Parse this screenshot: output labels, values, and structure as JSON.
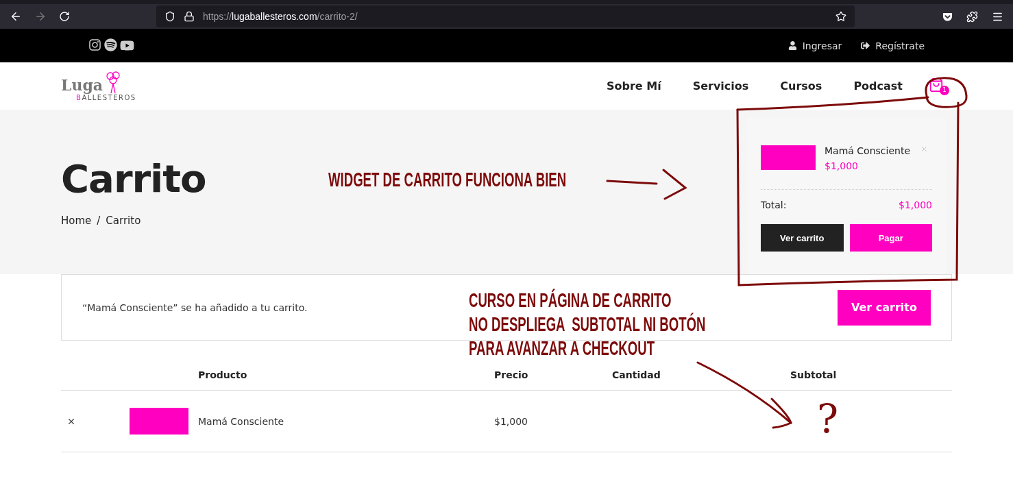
{
  "browser": {
    "url_scheme": "https://",
    "url_domain": "lugaballesteros.com",
    "url_path": "/carrito-2/"
  },
  "topbar": {
    "links": [
      {
        "label": "Ingresar",
        "kind": "user"
      },
      {
        "label": "Regístrate",
        "kind": "signup"
      }
    ]
  },
  "logo": {
    "name": "Luga",
    "sub_initial": "B",
    "sub_rest": "ALLESTEROS"
  },
  "nav": {
    "items": [
      "Sobre Mí",
      "Servicios",
      "Cursos",
      "Podcast"
    ],
    "cart_count": "1"
  },
  "hero": {
    "title": "Carrito",
    "breadcrumb": [
      "Home",
      "Carrito"
    ],
    "separator": "/"
  },
  "notice": {
    "text": "“Mamá Consciente” se ha añadido a tu carrito.",
    "button": "Ver carrito"
  },
  "table": {
    "columns": [
      "Producto",
      "Precio",
      "Cantidad",
      "Subtotal"
    ],
    "rows": [
      {
        "product": "Mamá Consciente",
        "price": "$1,000"
      }
    ]
  },
  "mini_cart": {
    "items": [
      {
        "name": "Mamá Consciente",
        "price": "$1,000"
      }
    ],
    "total_label": "Total:",
    "total_value": "$1,000",
    "buttons": [
      {
        "label": "Ver carrito",
        "kind": "dark"
      },
      {
        "label": "Pagar",
        "kind": "pink"
      }
    ]
  },
  "annotations": [
    {
      "text": "WIDGET DE CARRITO FUNCIONA BIEN"
    },
    {
      "text": "CURSO EN PÁGINA DE CARRITO\nNO DESPLIEGA  SUBTOTAL NI BOTÓN\nPARA AVANZAR A CHECKOUT"
    },
    {
      "text": "?"
    }
  ]
}
